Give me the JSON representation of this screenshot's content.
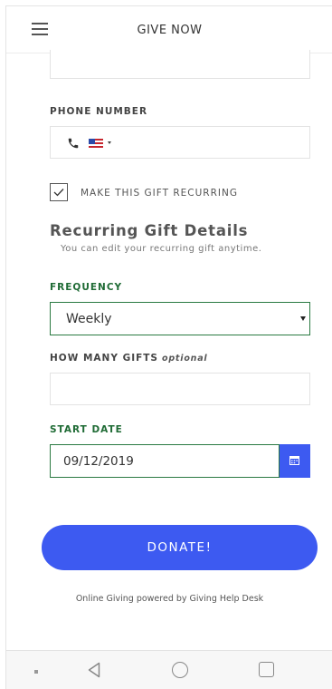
{
  "header": {
    "title": "GIVE NOW"
  },
  "form": {
    "phone_label": "PHONE NUMBER",
    "recurring_checkbox": {
      "label": "MAKE THIS GIFT RECURRING",
      "checked": true
    },
    "recurring_section": {
      "title": "Recurring Gift Details",
      "subtitle": "You can edit your recurring gift anytime."
    },
    "frequency": {
      "label": "FREQUENCY",
      "value": "Weekly"
    },
    "how_many": {
      "label": "HOW MANY GIFTS",
      "optional": "optional",
      "value": ""
    },
    "start_date": {
      "label": "START DATE",
      "value": "09/12/2019"
    },
    "donate_label": "DONATE!"
  },
  "footer": {
    "note": "Online Giving powered by Giving Help Desk"
  },
  "colors": {
    "accent": "#3d5af1",
    "green": "#1f6b35"
  },
  "icons": [
    "menu-icon",
    "phone-icon",
    "us-flag-icon",
    "check-icon",
    "chevron-down-icon",
    "calendar-icon",
    "back-icon",
    "home-icon",
    "recent-apps-icon"
  ]
}
